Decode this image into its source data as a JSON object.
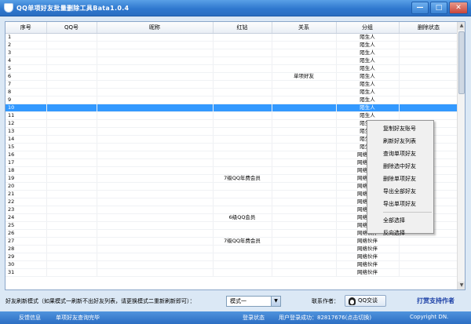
{
  "window": {
    "title": "QQ单项好友批量删除工具Bata1.0.4",
    "controls": [
      "—",
      "□",
      "✕"
    ]
  },
  "grid": {
    "columns": [
      "序号",
      "QQ号",
      "昵称",
      "红钻",
      "关系",
      "分组",
      "删除状态"
    ],
    "selected_row": 10,
    "rows": [
      {
        "no": "1",
        "qq": "",
        "nick": "",
        "red": "",
        "rel": "",
        "group": "陌生人"
      },
      {
        "no": "2",
        "qq": "",
        "nick": "",
        "red": "",
        "rel": "",
        "group": "陌生人"
      },
      {
        "no": "3",
        "qq": "",
        "nick": "",
        "red": "",
        "rel": "",
        "group": "陌生人"
      },
      {
        "no": "4",
        "qq": "",
        "nick": "",
        "red": "",
        "rel": "",
        "group": "陌生人"
      },
      {
        "no": "5",
        "qq": "",
        "nick": "",
        "red": "",
        "rel": "",
        "group": "陌生人"
      },
      {
        "no": "6",
        "qq": "",
        "nick": "",
        "red": "",
        "rel": "单项好友",
        "group": "陌生人"
      },
      {
        "no": "7",
        "qq": "",
        "nick": "",
        "red": "",
        "rel": "",
        "group": "陌生人"
      },
      {
        "no": "8",
        "qq": "",
        "nick": "",
        "red": "",
        "rel": "",
        "group": "陌生人"
      },
      {
        "no": "9",
        "qq": "",
        "nick": "",
        "red": "",
        "rel": "",
        "group": "陌生人"
      },
      {
        "no": "10",
        "qq": "",
        "nick": "",
        "red": "",
        "rel": "",
        "group": "陌生人"
      },
      {
        "no": "11",
        "qq": "",
        "nick": "",
        "red": "",
        "rel": "",
        "group": "陌生人"
      },
      {
        "no": "12",
        "qq": "",
        "nick": "",
        "red": "",
        "rel": "",
        "group": "陌生人"
      },
      {
        "no": "13",
        "qq": "",
        "nick": "",
        "red": "",
        "rel": "",
        "group": "陌生人"
      },
      {
        "no": "14",
        "qq": "",
        "nick": "",
        "red": "",
        "rel": "",
        "group": "陌生人"
      },
      {
        "no": "15",
        "qq": "",
        "nick": "",
        "red": "",
        "rel": "",
        "group": "陌生人"
      },
      {
        "no": "16",
        "qq": "",
        "nick": "",
        "red": "",
        "rel": "",
        "group": "网络伙伴"
      },
      {
        "no": "17",
        "qq": "",
        "nick": "",
        "red": "",
        "rel": "",
        "group": "网络伙伴"
      },
      {
        "no": "18",
        "qq": "",
        "nick": "",
        "red": "",
        "rel": "",
        "group": "网络伙伴"
      },
      {
        "no": "19",
        "qq": "",
        "nick": "",
        "red": "7级QQ年费会员",
        "rel": "",
        "group": "网络伙伴"
      },
      {
        "no": "20",
        "qq": "",
        "nick": "",
        "red": "",
        "rel": "",
        "group": "网络伙伴"
      },
      {
        "no": "21",
        "qq": "",
        "nick": "",
        "red": "",
        "rel": "",
        "group": "网络伙伴"
      },
      {
        "no": "22",
        "qq": "",
        "nick": "",
        "red": "",
        "rel": "",
        "group": "网络伙伴"
      },
      {
        "no": "23",
        "qq": "",
        "nick": "",
        "red": "",
        "rel": "",
        "group": "网络伙伴"
      },
      {
        "no": "24",
        "qq": "",
        "nick": "",
        "red": "6级QQ会员",
        "rel": "",
        "group": "网络伙伴"
      },
      {
        "no": "25",
        "qq": "",
        "nick": "",
        "red": "",
        "rel": "",
        "group": "网络伙伴"
      },
      {
        "no": "26",
        "qq": "",
        "nick": "",
        "red": "",
        "rel": "",
        "group": "网络伙伴"
      },
      {
        "no": "27",
        "qq": "",
        "nick": "",
        "red": "7级QQ年费会员",
        "rel": "",
        "group": "网络伙伴"
      },
      {
        "no": "28",
        "qq": "",
        "nick": "",
        "red": "",
        "rel": "",
        "group": "网络伙伴"
      },
      {
        "no": "29",
        "qq": "",
        "nick": "",
        "red": "",
        "rel": "",
        "group": "网络伙伴"
      },
      {
        "no": "30",
        "qq": "",
        "nick": "",
        "red": "",
        "rel": "",
        "group": "网络伙伴"
      },
      {
        "no": "31",
        "qq": "",
        "nick": "",
        "red": "",
        "rel": "",
        "group": "网络伙伴"
      }
    ]
  },
  "context_menu": {
    "items": [
      "复制好友账号",
      "刷新好友列表",
      "查询单项好友",
      "删除选中好友",
      "删除单项好友",
      "导出全部好友",
      "导出单项好友",
      "---",
      "全部选择",
      "反向选择"
    ]
  },
  "toolbar": {
    "mode_label": "好友刷新模式（如果模式一刷新不出好友列表，请更换模式二重新刷新即可）：",
    "mode_value": "模式一",
    "contact_label": "联系作者：",
    "qq_button": "QQ交谈",
    "support": "打赏支持作者"
  },
  "statusbar": {
    "feedback": "反馈信息",
    "query_done": "单项好友查询完毕",
    "login_state": "登录状态",
    "login_success": "用户登录成功：82817676(点击切换)",
    "copyright": "Copyright DN."
  },
  "colors": {
    "title_bar": "#2f78cf",
    "selection": "#3399ff",
    "status_bar": "#2c6ec3",
    "support_text": "#1b3fa6"
  }
}
